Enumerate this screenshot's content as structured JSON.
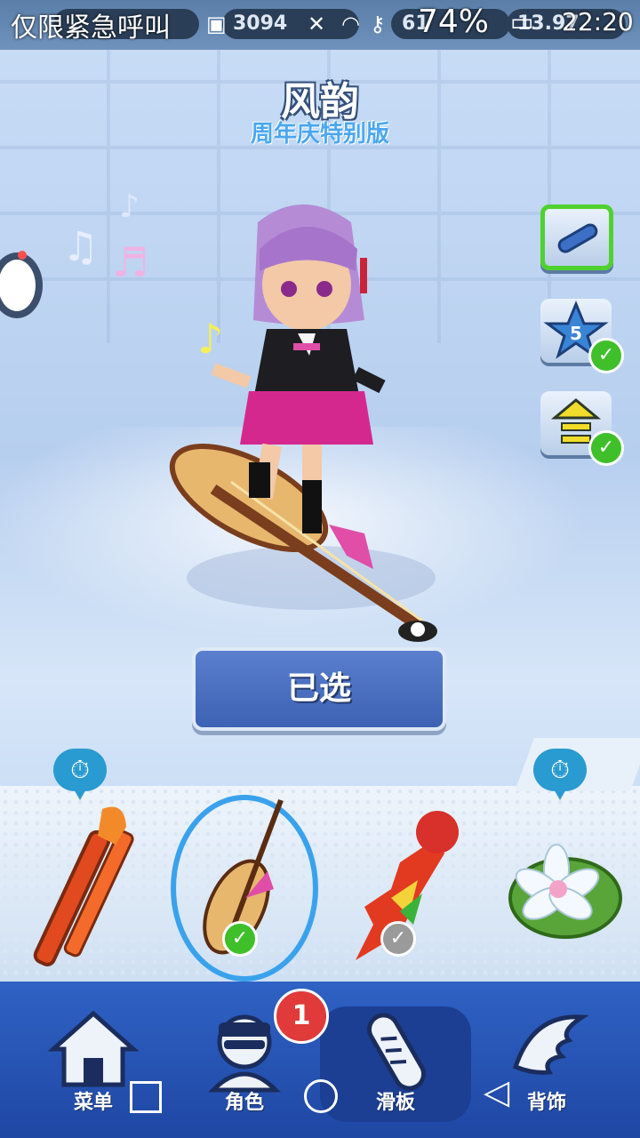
{
  "status_bar": {
    "emergency_text": "仅限紧急呼叫",
    "coins_text": "3094",
    "partial_left": "0",
    "tickets_text": "61",
    "battery_percent": "74%",
    "gems_text": "13.97",
    "time": "22:20",
    "icons": [
      "gallery-icon",
      "mute-icon",
      "wifi-icon",
      "key-icon",
      "battery-icon"
    ]
  },
  "header": {
    "title": "风韵",
    "subtitle": "周年庆特别版"
  },
  "side_buttons": [
    {
      "name": "board-type",
      "icon": "board-icon",
      "active": true
    },
    {
      "name": "star-level",
      "icon": "star-icon",
      "level": "5",
      "checked": true
    },
    {
      "name": "upgrade",
      "icon": "upgrade-arrow-icon",
      "checked": true
    }
  ],
  "main": {
    "selected_label": "已选"
  },
  "boards": [
    {
      "name": "horse-head-board",
      "timer": true,
      "status": "none"
    },
    {
      "name": "pipa-board",
      "timer": false,
      "status": "selected"
    },
    {
      "name": "fire-dragon-board",
      "timer": false,
      "status": "owned"
    },
    {
      "name": "lotus-board",
      "timer": true,
      "status": "none"
    }
  ],
  "nav": {
    "items": [
      {
        "label": "菜单",
        "icon": "home-icon"
      },
      {
        "label": "角色",
        "icon": "character-icon"
      },
      {
        "label": "滑板",
        "icon": "hoverboard-icon"
      },
      {
        "label": "背饰",
        "icon": "wings-icon"
      }
    ],
    "badge_count": "1"
  },
  "colors": {
    "accent_blue": "#3aa2ec",
    "check_green": "#3fbf2a",
    "nav_blue": "#2f62c4",
    "badge_red": "#e03a3a"
  }
}
